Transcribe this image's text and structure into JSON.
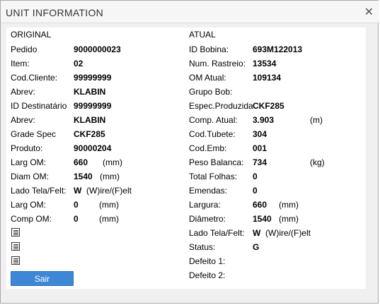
{
  "window": {
    "title": "UNIT INFORMATION",
    "close_icon": "close-icon"
  },
  "original": {
    "header": "ORIGINAL",
    "rows": [
      {
        "label": "Pedido",
        "value": "9000000023",
        "unit": ""
      },
      {
        "label": "Item:",
        "value": "02",
        "unit": ""
      },
      {
        "label": "Cod.Cliente:",
        "value": "99999999",
        "unit": ""
      },
      {
        "label": "Abrev:",
        "value": "KLABIN",
        "unit": ""
      },
      {
        "label": "ID Destinatário",
        "value": "99999999",
        "unit": ""
      },
      {
        "label": "Abrev:",
        "value": "KLABIN",
        "unit": ""
      },
      {
        "label": "Grade Spec",
        "value": "CKF285",
        "unit": ""
      },
      {
        "label": "Produto:",
        "value": "90000204",
        "unit": ""
      },
      {
        "label": "Larg OM:",
        "value": "660",
        "unit": "(mm)"
      },
      {
        "label": "Diam OM:",
        "value": "1540",
        "unit": "(mm)"
      },
      {
        "label": "Lado Tela/Felt:",
        "value": "W",
        "unit": "(W)ire/(F)elt"
      },
      {
        "label": "Larg OM:",
        "value": "0",
        "unit": "(mm)"
      },
      {
        "label": "Comp OM:",
        "value": "0",
        "unit": "(mm)"
      }
    ]
  },
  "atual": {
    "header": "ATUAL",
    "rows": [
      {
        "label": "ID Bobina:",
        "value": "693M122013",
        "unit": ""
      },
      {
        "label": "Num. Rastreio:",
        "value": "13534",
        "unit": ""
      },
      {
        "label": "OM Atual:",
        "value": "109134",
        "unit": ""
      },
      {
        "label": "Grupo Bob:",
        "value": "",
        "unit": ""
      },
      {
        "label": "Espec.Produzida",
        "value": "CKF285",
        "unit": ""
      },
      {
        "label": "Comp. Atual:",
        "value": "3.903",
        "unit": "(m)"
      },
      {
        "label": "Cod.Tubete:",
        "value": "304",
        "unit": ""
      },
      {
        "label": "Cod.Emb:",
        "value": "001",
        "unit": ""
      },
      {
        "label": "Peso Balanca:",
        "value": "734",
        "unit": "(kg)"
      },
      {
        "label": "Total Folhas:",
        "value": "0",
        "unit": ""
      },
      {
        "label": "Emendas:",
        "value": "0",
        "unit": ""
      },
      {
        "label": "Largura:",
        "value": "660",
        "unit": "(mm)"
      },
      {
        "label": "Diâmetro:",
        "value": "1540",
        "unit": "(mm)"
      },
      {
        "label": "Lado Tela/Felt:",
        "value": "W",
        "unit": "(W)ire/(F)elt"
      },
      {
        "label": "Status:",
        "value": "G",
        "unit": ""
      },
      {
        "label": "Defeito 1:",
        "value": "",
        "unit": ""
      },
      {
        "label": "Defeito 2:",
        "value": "",
        "unit": ""
      }
    ]
  },
  "doc_icons": [
    "document-icon",
    "document-icon",
    "document-icon"
  ],
  "footer": {
    "exit_label": "Sair"
  },
  "colors": {
    "button_bg": "#3d87d6",
    "dialog_bg": "#f0f0f0"
  }
}
